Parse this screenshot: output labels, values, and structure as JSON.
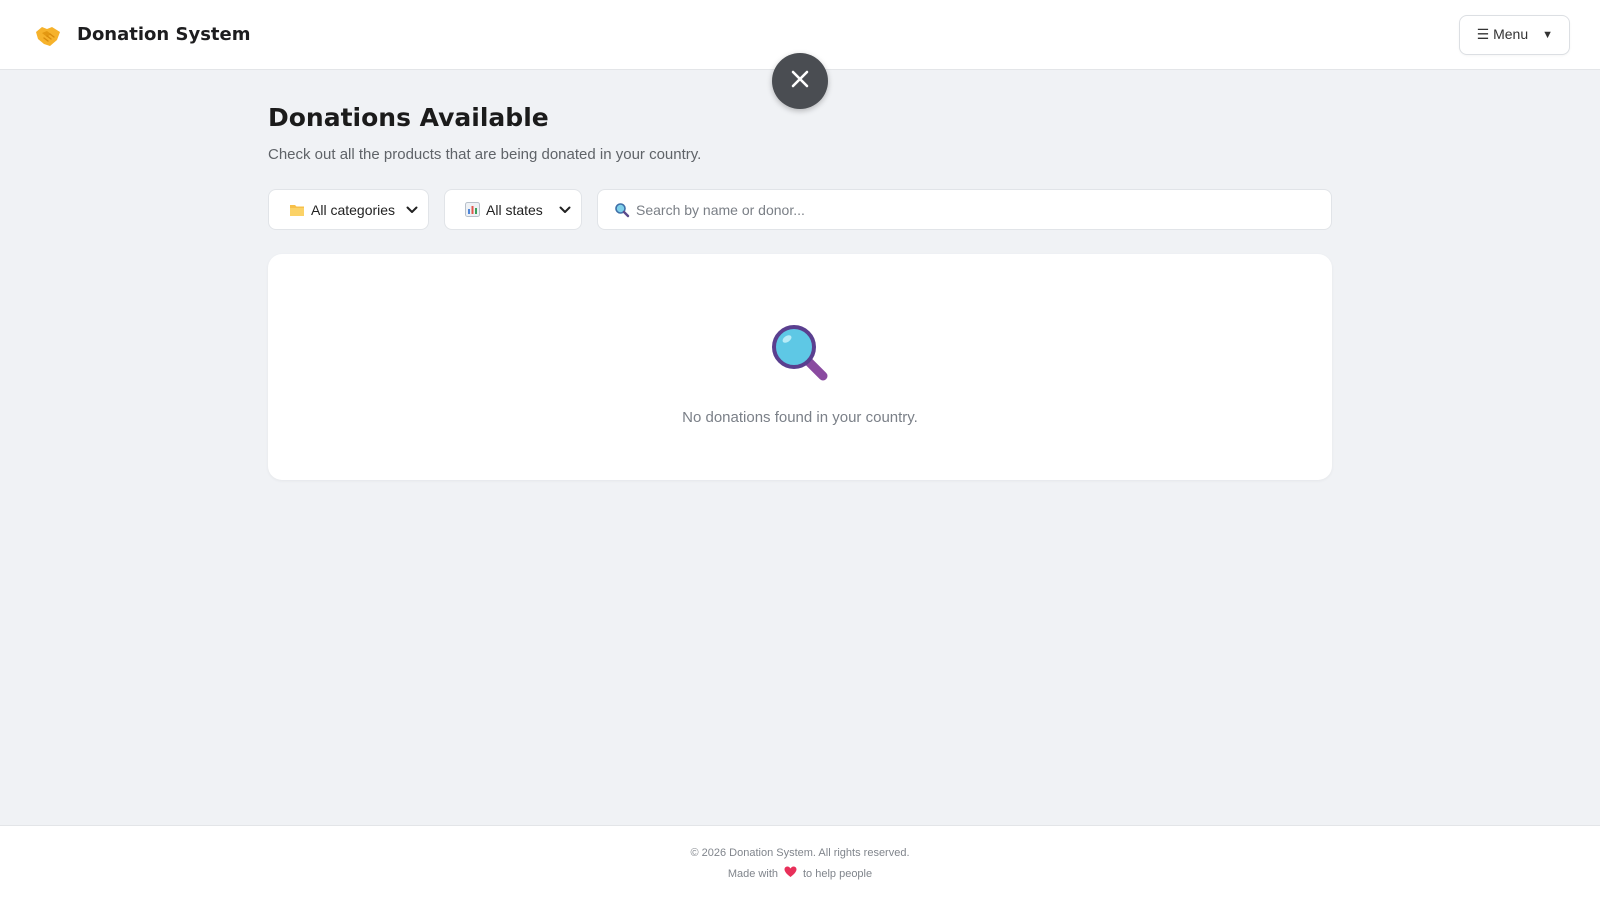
{
  "header": {
    "logo_icon": "handshake-icon",
    "title": "Donation System",
    "menu_label": "☰ Menu",
    "menu_caret": "▼"
  },
  "overlay": {
    "close_icon": "close-icon"
  },
  "main": {
    "title": "Donations Available",
    "subtitle": "Check out all the products that are being donated in your country.",
    "filters": {
      "category": {
        "icon": "folder-icon",
        "value": "All categories"
      },
      "state": {
        "icon": "bar-chart-icon",
        "value": "All states"
      },
      "search": {
        "icon": "search-icon",
        "placeholder": "Search by name or donor...",
        "value": ""
      }
    },
    "empty_state": {
      "icon": "magnifier-icon",
      "message": "No donations found in your country."
    }
  },
  "footer": {
    "copyright": "© 2026 Donation System. All rights reserved.",
    "made_with": "Made with",
    "heart_icon": "heart-icon",
    "tagline": "to help people"
  },
  "colors": {
    "background": "#f0f2f5",
    "surface": "#ffffff",
    "close_button": "#4a4d52",
    "heart": "#e8305a",
    "magnifier_lens": "#5ec8e5",
    "magnifier_handle": "#8a4aa0"
  }
}
